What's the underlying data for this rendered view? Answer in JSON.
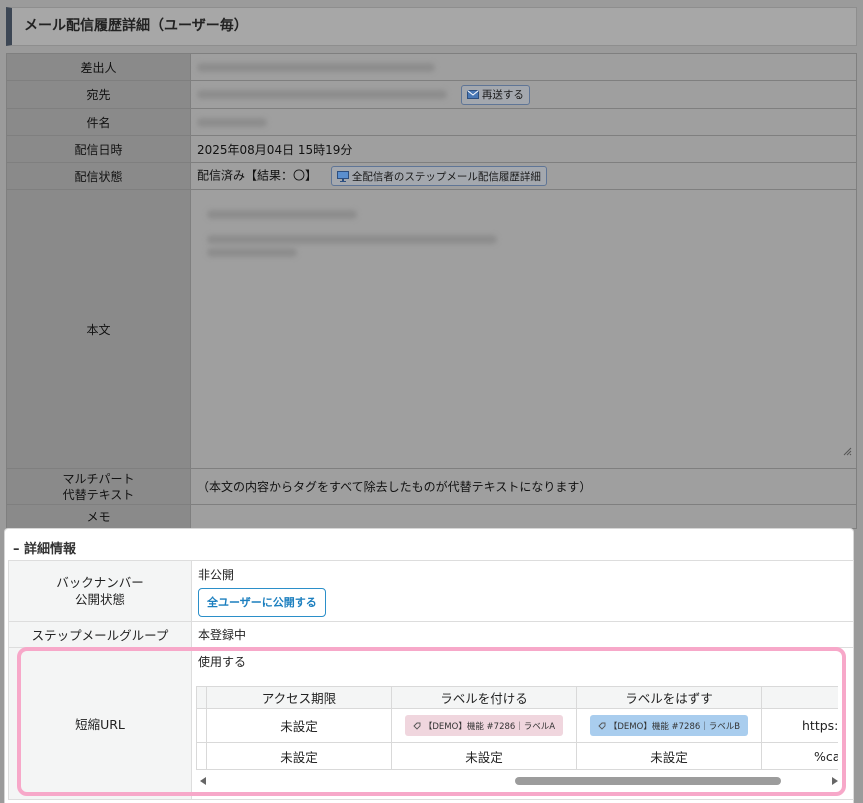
{
  "page_title": "メール配信履歴詳細（ユーザー毎）",
  "detail_rows": {
    "sender_label": "差出人",
    "recipient_label": "宛先",
    "resend_label": "再送する",
    "subject_label": "件名",
    "sent_at_label": "配信日時",
    "sent_at_value": "2025年08月04日 15時19分",
    "status_label": "配信状態",
    "status_value": "配信済み【結果：〇】",
    "step_history_label": "全配信者のステップメール配信履歴詳細",
    "body_label": "本文",
    "multipart_label_1": "マルチパート",
    "multipart_label_2": "代替テキスト",
    "multipart_value": "（本文の内容からタグをすべて除去したものが代替テキストになります）",
    "memo_label": "メモ"
  },
  "info_panel": {
    "heading": "– 詳細情報",
    "backnumber_label_1": "バックナンバー",
    "backnumber_label_2": "公開状態",
    "backnumber_value": "非公開",
    "publish_button": "全ユーザーに公開する",
    "step_group_label": "ステップメールグループ",
    "step_group_value": "本登録中",
    "short_url_label": "短縮URL",
    "short_url_value": "使用する"
  },
  "short_url_table": {
    "headers": [
      "アクセス期限",
      "ラベルを付ける",
      "ラベルをはずす",
      ""
    ],
    "row1": {
      "access": "未設定",
      "add_label": "【DEMO】機能 #7286｜ラベルA",
      "remove_label": "【DEMO】機能 #7286｜ラベルB",
      "url": "https:/"
    },
    "row2": {
      "access": "未設定",
      "add_label": "未設定",
      "remove_label": "未設定",
      "url": "%ca"
    }
  },
  "colors": {
    "highlight": "#f7a8c9",
    "accent_blue": "#1c7fbf",
    "pill_a": "#f0d6de",
    "pill_b": "#a9cdee"
  }
}
